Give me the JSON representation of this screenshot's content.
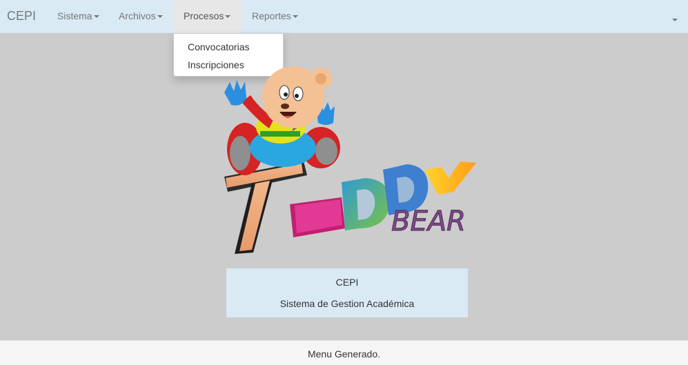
{
  "navbar": {
    "brand": "CEPI",
    "menus": [
      {
        "label": "Sistema"
      },
      {
        "label": "Archivos"
      },
      {
        "label": "Procesos"
      },
      {
        "label": "Reportes"
      }
    ]
  },
  "dropdown": {
    "items": [
      "Convocatorias",
      "Inscripciones"
    ]
  },
  "logo": {
    "letters_main": "EDDY",
    "letter_t": "T",
    "word_bear": "BEAR"
  },
  "info": {
    "line1": "CEPI",
    "line2": "Sistema de Gestion Académica"
  },
  "footer": {
    "text": "Menu Generado."
  },
  "colors": {
    "navbar_bg": "#d9eaf4",
    "page_bg": "#cccccc",
    "info_bg": "#d9eaf4",
    "footer_bg": "#f5f5f5"
  }
}
